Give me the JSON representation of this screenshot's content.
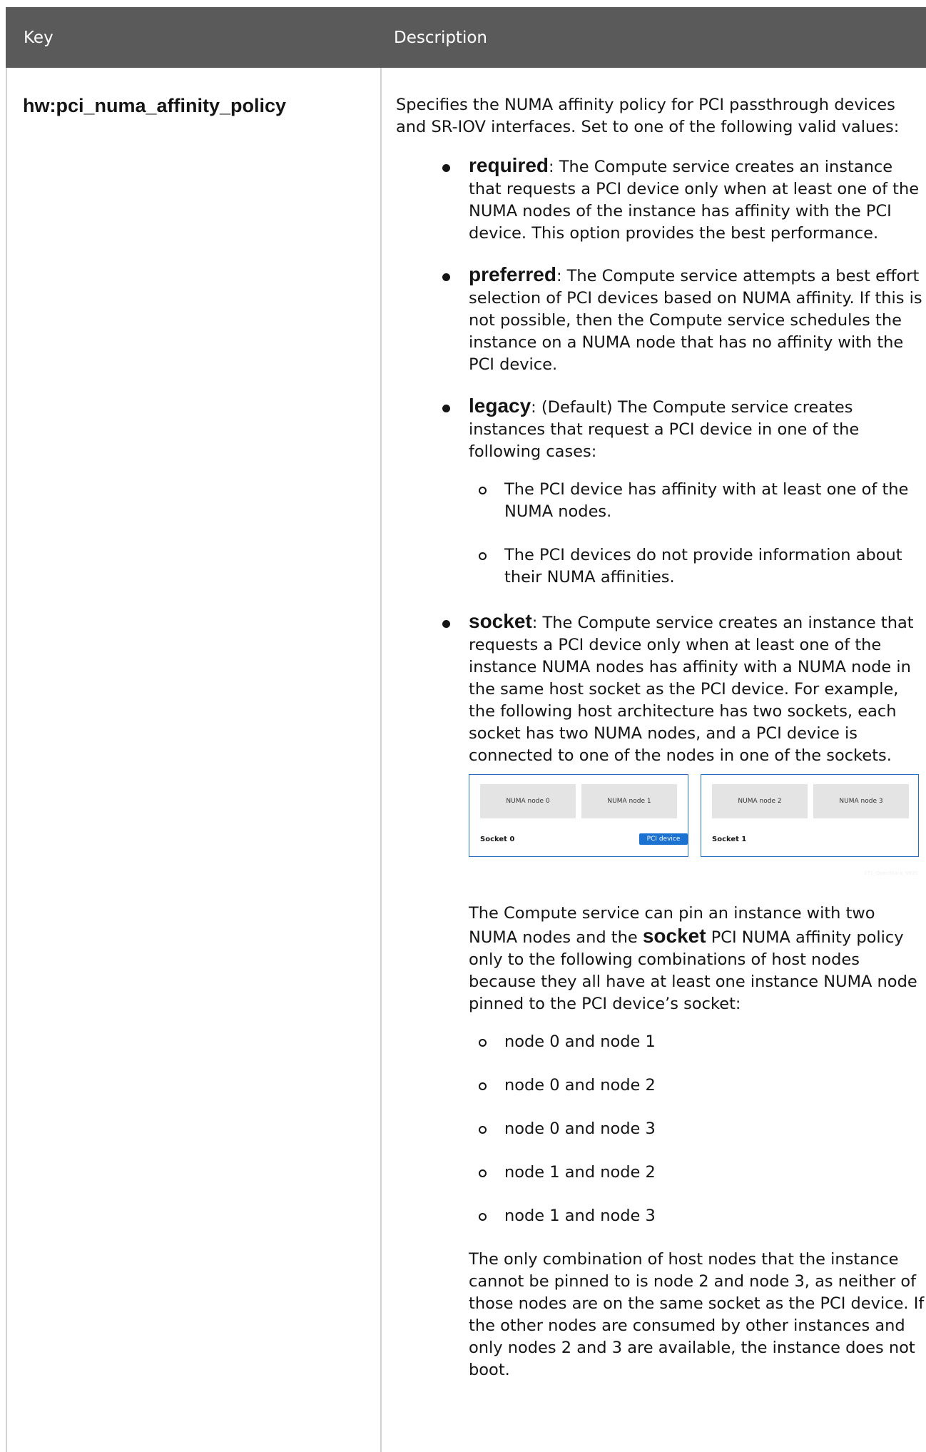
{
  "table": {
    "header": {
      "key": "Key",
      "description": "Description"
    },
    "row": {
      "key": "hw:pci_numa_affinity_policy",
      "intro": "Specifies the NUMA affinity policy for PCI passthrough devices and SR-IOV interfaces. Set to one of the following valid values:",
      "values": [
        {
          "term": "required",
          "text": ": The Compute service creates an instance that requests a PCI device only when at least one of the NUMA nodes of the instance has affinity with the PCI device. This option provides the best performance."
        },
        {
          "term": "preferred",
          "text": ": The Compute service attempts a best effort selection of PCI devices based on NUMA affinity. If this is not possible, then the Compute service schedules the instance on a NUMA node that has no affinity with the PCI device."
        },
        {
          "term": "legacy",
          "text": ": (Default) The Compute service creates instances that request a PCI device in one of the following cases:",
          "cases": [
            "The PCI device has affinity with at least one of the NUMA nodes.",
            "The PCI devices do not provide information about their NUMA affinities."
          ]
        },
        {
          "term": "socket",
          "text": ": The Compute service creates an instance that requests a PCI device only when at least one of the instance NUMA nodes has affinity with a NUMA node in the same host socket as the PCI device. For example, the following host architecture has two sockets, each socket has two NUMA nodes, and a PCI device is connected to one of the nodes in one of the sockets."
        }
      ],
      "diagram": {
        "sockets": [
          {
            "label": "Socket 0",
            "nodes": [
              "NUMA node 0",
              "NUMA node 1"
            ],
            "device": "PCI device"
          },
          {
            "label": "Socket 1",
            "nodes": [
              "NUMA node 2",
              "NUMA node 3"
            ]
          }
        ],
        "watermark": "171_OpenStack_0920"
      },
      "pin_intro_before": "The Compute service can pin an instance with two NUMA nodes and the ",
      "pin_intro_term": "socket",
      "pin_intro_after": " PCI NUMA affinity policy only to the following combinations of host nodes because they all have at least one instance NUMA node pinned to the PCI device’s socket:",
      "combinations": [
        "node 0 and node 1",
        "node 0 and node 2",
        "node 0 and node 3",
        "node 1 and node 2",
        "node 1 and node 3"
      ],
      "closing": "The only combination of host nodes that the instance cannot be pinned to is node 2 and node 3, as neither of those nodes are on the same socket as the PCI device. If the other nodes are consumed by other instances and only nodes 2 and 3 are available, the instance does not boot."
    }
  }
}
